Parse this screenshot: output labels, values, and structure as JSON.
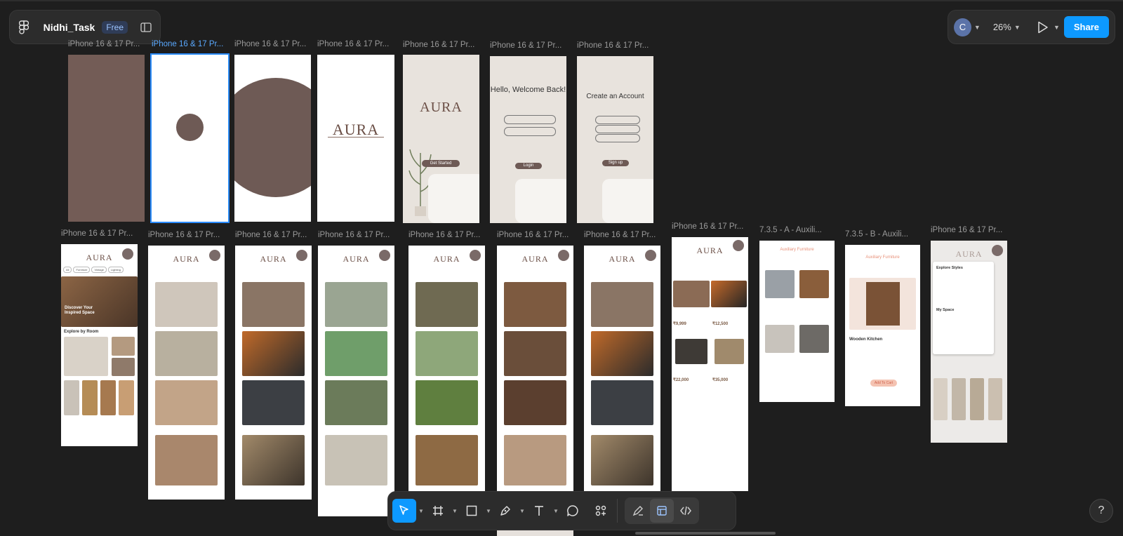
{
  "file": {
    "name": "Nidhi_Task",
    "plan_badge": "Free"
  },
  "right_panel": {
    "avatar_initial": "C",
    "zoom": "26%",
    "share_label": "Share"
  },
  "frames_row1": [
    {
      "label": "iPhone 16 & 17 Pr..."
    },
    {
      "label": "iPhone 16 & 17 Pr..."
    },
    {
      "label": "iPhone 16 & 17 Pr..."
    },
    {
      "label": "iPhone 16 & 17 Pr..."
    },
    {
      "label": "iPhone 16 & 17 Pr..."
    },
    {
      "label": "iPhone 16 & 17 Pr..."
    },
    {
      "label": "iPhone 16 & 17 Pr..."
    }
  ],
  "frames_row2": [
    {
      "label": "iPhone 16 & 17 Pr..."
    },
    {
      "label": "iPhone 16 & 17 Pr..."
    },
    {
      "label": "iPhone 16 & 17 Pr..."
    },
    {
      "label": "iPhone 16 & 17 Pr..."
    },
    {
      "label": "iPhone 16 & 17 Pr..."
    },
    {
      "label": "iPhone 16 & 17 Pr..."
    },
    {
      "label": "iPhone 16 & 17 Pr..."
    },
    {
      "label": "iPhone 16 & 17 Pr..."
    },
    {
      "label": "7.3.5 - A - Auxili..."
    },
    {
      "label": "7.3.5 - B - Auxili..."
    },
    {
      "label": "iPhone 16 & 17 Pr..."
    }
  ],
  "screen_text": {
    "brand": "AURA",
    "get_started": "Get Started",
    "welcome": "Hello, Welcome Back!",
    "login": "Login",
    "create_account": "Create an Account",
    "sign_up": "Sign up",
    "discover": "Discover Your Inspired Space",
    "explore_room": "Explore by Room",
    "tab_all": "All",
    "tab_furniture": "Furniture",
    "tab_vintage": "Vintage",
    "tab_lighting": "Lighting",
    "tab_show": "Show you",
    "price1": "₹9,999",
    "price2": "₹12,500",
    "price3": "₹22,000",
    "price4": "₹35,000",
    "aux_title": "Auxiliary Furniture",
    "wooden_kitchen": "Wooden Kitchen",
    "add_to_cart": "Add To Cart",
    "explore_styles": "Explore Styles",
    "my_space": "My Space"
  },
  "toolbar": {
    "tools": [
      "move-tool",
      "frame-tool",
      "shape-tool",
      "pen-tool",
      "text-tool",
      "comment-tool",
      "actions-tool"
    ]
  },
  "help_label": "?",
  "colors": {
    "brand_brown": "#6e5a55",
    "accent_blue": "#0d99ff",
    "canvas": "#1e1e1e"
  }
}
